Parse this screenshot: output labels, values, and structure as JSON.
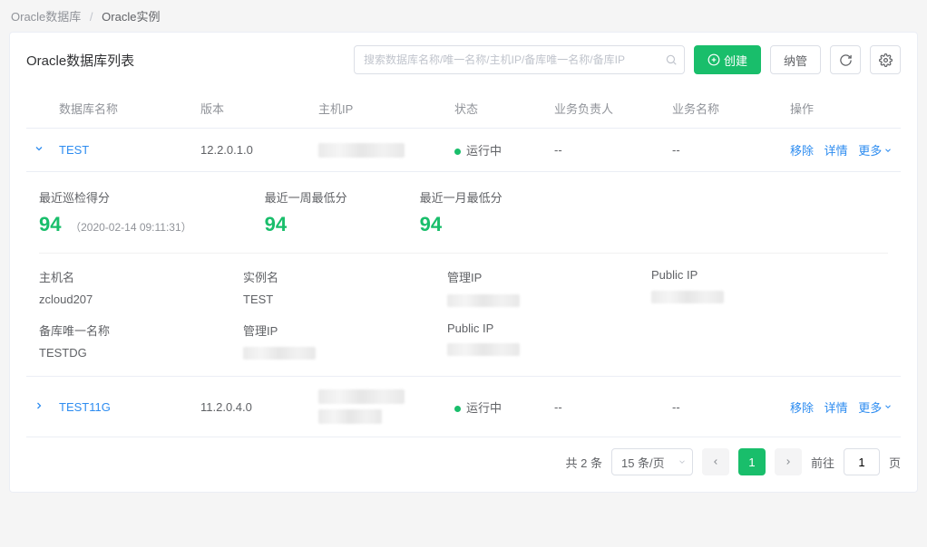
{
  "breadcrumb": {
    "parent": "Oracle数据库",
    "current": "Oracle实例"
  },
  "header": {
    "title": "Oracle数据库列表",
    "search_placeholder": "搜索数据库名称/唯一名称/主机IP/备库唯一名称/备库IP",
    "create_btn": "创建",
    "manage_btn": "纳管"
  },
  "columns": {
    "name": "数据库名称",
    "version": "版本",
    "host_ip": "主机IP",
    "status": "状态",
    "owner": "业务负责人",
    "biz_name": "业务名称",
    "actions": "操作"
  },
  "rows": [
    {
      "name": "TEST",
      "version": "12.2.0.1.0",
      "status": "运行中",
      "owner": "--",
      "biz": "--",
      "expanded": true
    },
    {
      "name": "TEST11G",
      "version": "11.2.0.4.0",
      "status": "运行中",
      "owner": "--",
      "biz": "--",
      "expanded": false
    }
  ],
  "row_actions": {
    "remove": "移除",
    "detail": "详情",
    "more": "更多"
  },
  "expanded_detail": {
    "score_recent_label": "最近巡检得分",
    "score_recent_value": "94",
    "score_recent_ts": "（2020-02-14 09:11:31）",
    "score_week_label": "最近一周最低分",
    "score_week_value": "94",
    "score_month_label": "最近一月最低分",
    "score_month_value": "94",
    "host_label": "主机名",
    "host_value": "zcloud207",
    "instance_label": "实例名",
    "instance_value": "TEST",
    "mgmt_ip_label": "管理IP",
    "public_ip_label": "Public IP",
    "standby_label": "备库唯一名称",
    "standby_value": "TESTDG",
    "mgmt_ip_label2": "管理IP",
    "public_ip_label2": "Public IP"
  },
  "pagination": {
    "total_text": "共 2 条",
    "page_size": "15 条/页",
    "current": "1",
    "goto_prefix": "前往",
    "goto_suffix": "页",
    "goto_value": "1"
  }
}
